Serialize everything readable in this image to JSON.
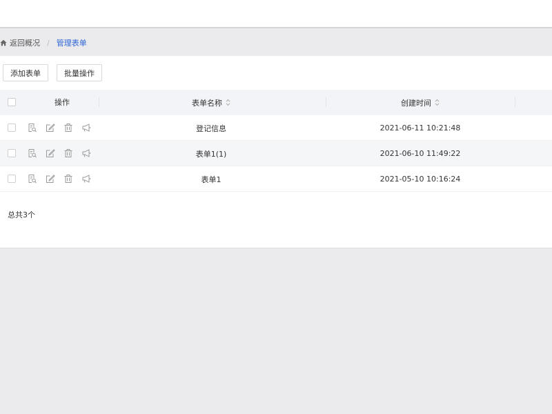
{
  "breadcrumb": {
    "home_label": "返回概况",
    "separator": "/",
    "current": "管理表单"
  },
  "toolbar": {
    "add_label": "添加表单",
    "batch_label": "批量操作"
  },
  "table": {
    "headers": {
      "ops": "操作",
      "name": "表单名称",
      "time": "创建时间"
    },
    "rows": [
      {
        "name": "登记信息",
        "time": "2021-06-11 10:21:48"
      },
      {
        "name": "表单1(1)",
        "time": "2021-06-10 11:49:22"
      },
      {
        "name": "表单1",
        "time": "2021-05-10 10:16:24"
      }
    ]
  },
  "footer": {
    "total": "总共3个"
  },
  "icons": {
    "home": "home-icon",
    "preview": "preview-icon",
    "edit": "edit-icon",
    "delete": "trash-icon",
    "publish": "megaphone-icon",
    "sort": "sort-icon"
  },
  "colors": {
    "accent": "#2f65d6",
    "icon_gray": "#999999"
  }
}
